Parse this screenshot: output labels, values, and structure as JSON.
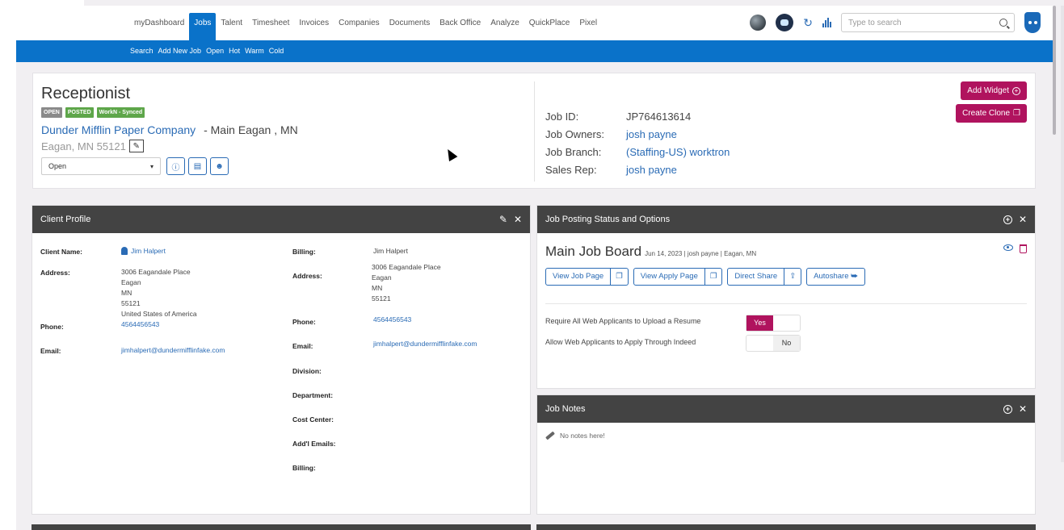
{
  "nav": {
    "tabs": [
      "myDashboard",
      "Jobs",
      "Talent",
      "Timesheet",
      "Invoices",
      "Companies",
      "Documents",
      "Back Office",
      "Analyze",
      "QuickPlace",
      "Pixel"
    ],
    "search_placeholder": "Type to search",
    "subnav": [
      "Search",
      "Add New Job",
      "Open",
      "Hot",
      "Warm",
      "Cold"
    ]
  },
  "job": {
    "title": "Receptionist",
    "badges": [
      "OPEN",
      "POSTED",
      "WorkN - Synced"
    ],
    "company": "Dunder Mifflin Paper Company",
    "company_sub": "- Main Eagan , MN",
    "location": "Eagan, MN 55121",
    "status": "Open",
    "meta": {
      "job_id_label": "Job ID:",
      "job_id": "JP764613614",
      "owners_label": "Job Owners:",
      "owners": "josh payne",
      "branch_label": "Job Branch:",
      "branch": "(Staffing-US) worktron",
      "rep_label": "Sales Rep:",
      "rep": "josh payne"
    },
    "add_widget": "Add Widget",
    "create_clone": "Create Clone"
  },
  "client_profile": {
    "title": "Client Profile",
    "client_name_label": "Client Name:",
    "client_name": "Jim Halpert",
    "address_label": "Address:",
    "address_lines": [
      "3006 Eagandale Place",
      "Eagan",
      "MN",
      "55121",
      "United States of America"
    ],
    "phone_label": "Phone:",
    "phone": "4564456543",
    "email_label": "Email:",
    "email": "jimhalpert@dundermifflinfake.com",
    "billing_label": "Billing:",
    "billing": "Jim Halpert",
    "billing_address_label": "Address:",
    "billing_address_lines": [
      "3006 Eagandale Place",
      "Eagan",
      "MN",
      "55121"
    ],
    "billing_phone_label": "Phone:",
    "billing_phone": "4564456543",
    "billing_email_label": "Email:",
    "billing_email": "jimhalpert@dundermifflinfake.com",
    "division_label": "Division:",
    "department_label": "Department:",
    "cost_center_label": "Cost Center:",
    "addl_emails_label": "Add'l Emails:",
    "billing2_label": "Billing:"
  },
  "posting": {
    "title": "Job Posting Status and Options",
    "board": "Main Job Board",
    "board_sub": "Jun 14, 2023 | josh payne | Eagan, MN",
    "view_job_page": "View Job Page",
    "view_apply_page": "View Apply Page",
    "direct_share": "Direct Share",
    "autoshare": "Autoshare",
    "require_resume_label": "Require All Web Applicants to Upload a Resume",
    "require_resume_value": "Yes",
    "indeed_label": "Allow Web Applicants to Apply Through Indeed",
    "indeed_value": "No"
  },
  "notes": {
    "title": "Job Notes",
    "empty": "No notes here!"
  },
  "colors": {
    "brand_blue": "#0a72c9",
    "accent_magenta": "#b0135e",
    "panel_header": "#434343",
    "badge_green": "#5ea64a"
  }
}
